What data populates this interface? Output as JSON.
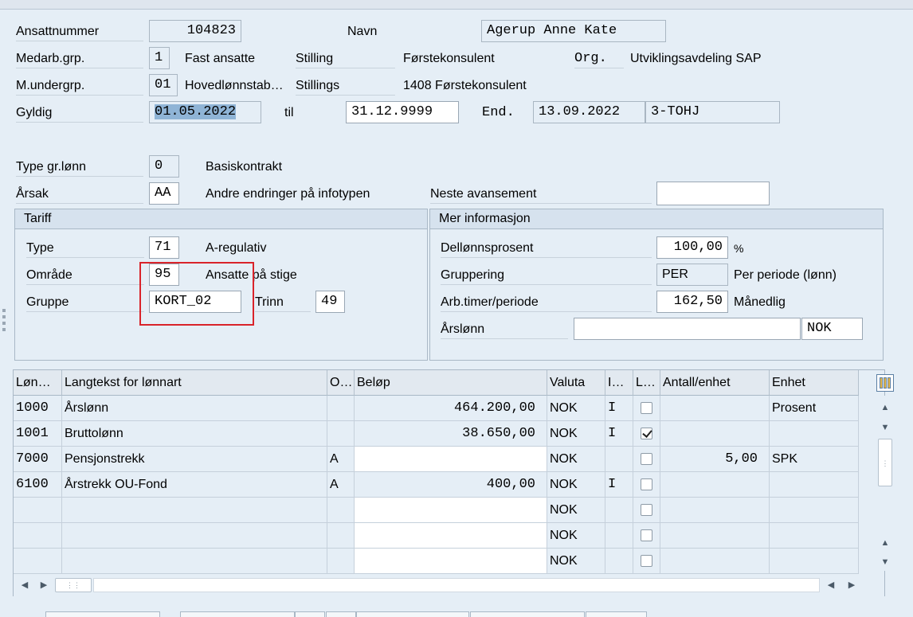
{
  "header": {
    "ansattnummer_label": "Ansattnummer",
    "ansattnummer": "104823",
    "navn_label": "Navn",
    "navn": "Agerup Anne Kate",
    "medarb_label": "Medarb.grp.",
    "medarb_code": "1",
    "medarb_text": "Fast ansatte",
    "stilling_label": "Stilling",
    "stilling_text": "Førstekonsulent",
    "org_label": "Org.",
    "org_text": "Utviklingsavdeling SAP",
    "mundergrp_label": "M.undergrp.",
    "mundergrp_code": "01",
    "mundergrp_text": "Hovedlønnstab…",
    "stillings_label": "Stillings",
    "stillings_text": "1408 Førstekonsulent",
    "gyldig_label": "Gyldig",
    "gyldig_from": "01.05.2022",
    "til_label": "til",
    "gyldig_to": "31.12.9999",
    "end_label": "End.",
    "end_date": "13.09.2022",
    "end_user": "3-TOHJ"
  },
  "basis": {
    "type_label": "Type gr.lønn",
    "type_code": "0",
    "type_text": "Basiskontrakt",
    "arsak_label": "Årsak",
    "arsak_code": "AA",
    "arsak_text": "Andre endringer på infotypen",
    "neste_label": "Neste avansement",
    "neste_value": ""
  },
  "tariff": {
    "title": "Tariff",
    "type_label": "Type",
    "type_code": "71",
    "type_text": "A-regulativ",
    "omrade_label": "Område",
    "omrade_code": "95",
    "omrade_text": "Ansatte på stige",
    "gruppe_label": "Gruppe",
    "gruppe_code": "KORT_02",
    "trinn_label": "Trinn",
    "trinn_value": "49"
  },
  "mer": {
    "title": "Mer informasjon",
    "dellonn_label": "Dellønnsprosent",
    "dellonn_value": "100,00",
    "dellonn_unit": "%",
    "grupp_label": "Gruppering",
    "grupp_code": "PER",
    "grupp_text": "Per periode (lønn)",
    "arb_label": "Arb.timer/periode",
    "arb_value": "162,50",
    "arb_text": "Månedlig",
    "arslonn_label": "Årslønn",
    "arslonn_value": "",
    "arslonn_currency": "NOK"
  },
  "table": {
    "columns": [
      "Løn…",
      "Langtekst for lønnart",
      "O…",
      "Beløp",
      "Valuta",
      "I…",
      "L…",
      "Antall/enhet",
      "Enhet"
    ],
    "rows": [
      {
        "lonnart": "1000",
        "tekst": "Årslønn",
        "o": "",
        "belop": "464.200,00",
        "valuta": "NOK",
        "i": "I",
        "checked": false,
        "antall": "",
        "enhet": "Prosent"
      },
      {
        "lonnart": "1001",
        "tekst": "Bruttolønn",
        "o": "",
        "belop": "38.650,00",
        "valuta": "NOK",
        "i": "I",
        "checked": true,
        "antall": "",
        "enhet": ""
      },
      {
        "lonnart": "7000",
        "tekst": "Pensjonstrekk",
        "o": "A",
        "belop": "",
        "valuta": "NOK",
        "i": "",
        "checked": false,
        "antall": "5,00",
        "enhet": "SPK"
      },
      {
        "lonnart": "6100",
        "tekst": "Årstrekk OU-Fond",
        "o": "A",
        "belop": "400,00",
        "valuta": "NOK",
        "i": "I",
        "checked": false,
        "antall": "",
        "enhet": ""
      },
      {
        "lonnart": "",
        "tekst": "",
        "o": "",
        "belop": "",
        "valuta": "NOK",
        "i": "",
        "checked": false,
        "antall": "",
        "enhet": ""
      },
      {
        "lonnart": "",
        "tekst": "",
        "o": "",
        "belop": "",
        "valuta": "NOK",
        "i": "",
        "checked": false,
        "antall": "",
        "enhet": ""
      },
      {
        "lonnart": "",
        "tekst": "",
        "o": "",
        "belop": "",
        "valuta": "NOK",
        "i": "",
        "checked": false,
        "antall": "",
        "enhet": ""
      }
    ]
  },
  "icons": [
    "column-settings-icon",
    "scroll-up-icon",
    "scroll-down-icon",
    "scroll-left-icon",
    "scroll-right-icon"
  ],
  "colors": {
    "background": "#e5eef6",
    "highlight": "#8fb4d6",
    "annotation_red": "#d9232a"
  }
}
